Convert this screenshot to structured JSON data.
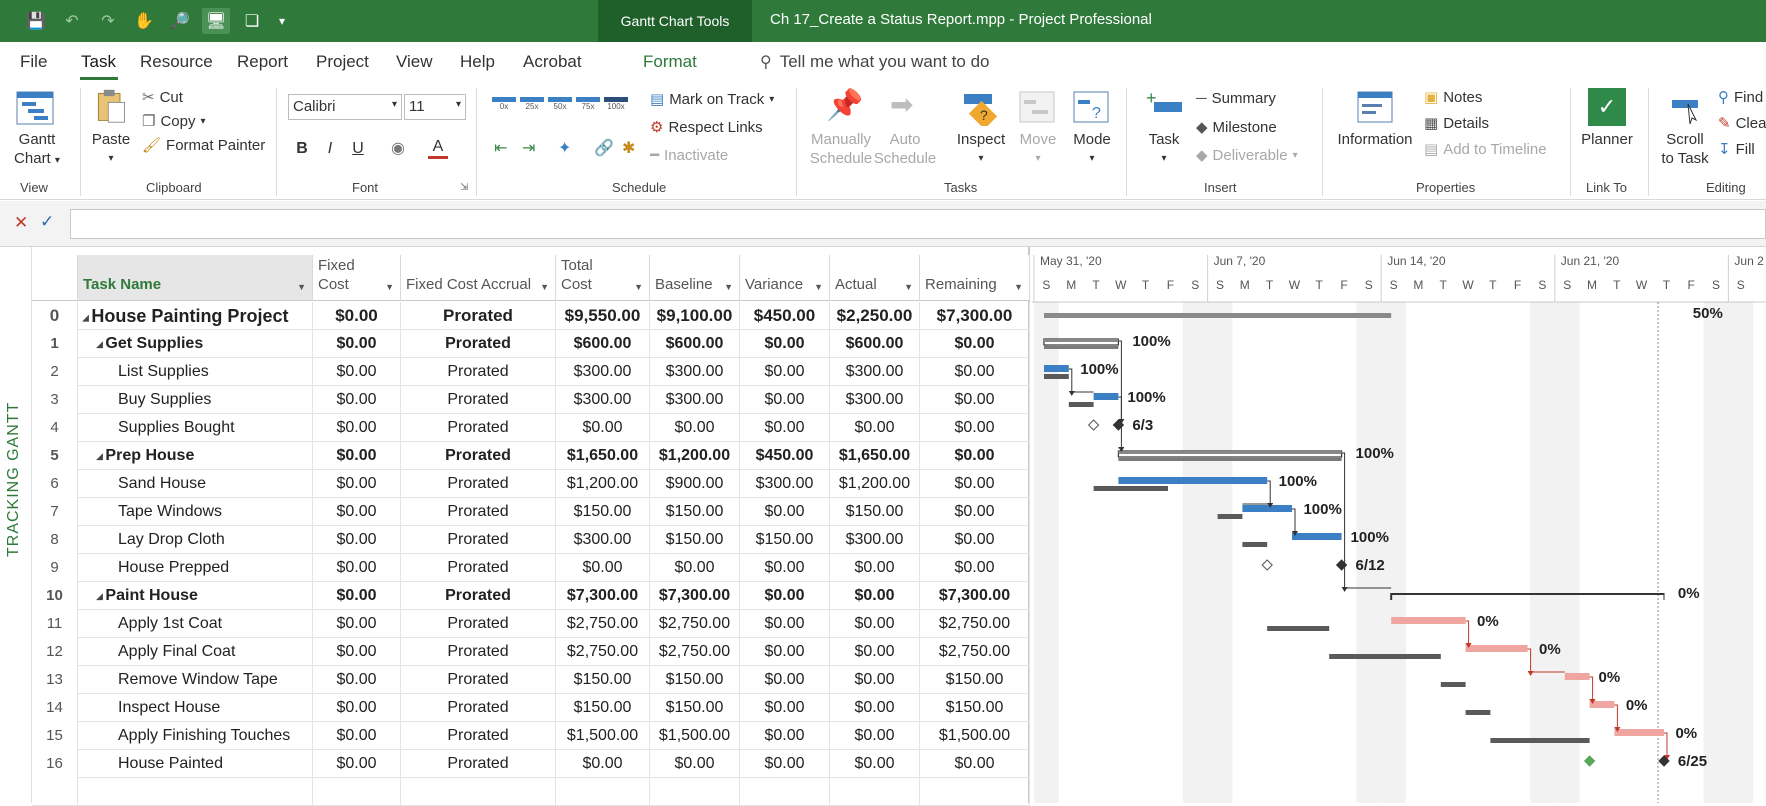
{
  "window": {
    "tools_tab": "Gantt Chart Tools",
    "title": "Ch 17_Create a Status Report.mpp  -  Project Professional"
  },
  "menu": [
    "File",
    "Task",
    "Resource",
    "Report",
    "Project",
    "View",
    "Help",
    "Acrobat",
    "Format"
  ],
  "active_menu": "Task",
  "tellme": "Tell me what you want to do",
  "ribbon": {
    "view": {
      "gantt": "Gantt",
      "chart": "Chart",
      "label": "View"
    },
    "clipboard": {
      "paste": "Paste",
      "cut": "Cut",
      "copy": "Copy",
      "format_painter": "Format Painter",
      "label": "Clipboard"
    },
    "font": {
      "family": "Calibri",
      "size": "11",
      "bold": "B",
      "italic": "I",
      "underline": "U",
      "label": "Font"
    },
    "schedule": {
      "pct": [
        "0x",
        "25x",
        "50x",
        "75x",
        "100x"
      ],
      "mark_on_track": "Mark on Track",
      "respect_links": "Respect Links",
      "inactivate": "Inactivate",
      "label": "Schedule"
    },
    "tasks": {
      "manually1": "Manually",
      "manually2": "Schedule",
      "auto1": "Auto",
      "auto2": "Schedule",
      "inspect": "Inspect",
      "move": "Move",
      "mode": "Mode",
      "label": "Tasks"
    },
    "insert": {
      "task": "Task",
      "summary": "Summary",
      "milestone": "Milestone",
      "deliverable": "Deliverable",
      "label": "Insert"
    },
    "properties": {
      "information": "Information",
      "notes": "Notes",
      "details": "Details",
      "add_to_timeline": "Add to Timeline",
      "label": "Properties"
    },
    "linkto": {
      "planner": "Planner",
      "label": "Link To"
    },
    "editing": {
      "scroll1": "Scroll",
      "scroll2": "to Task",
      "find": "Find",
      "clear": "Clear",
      "fill": "Fill",
      "label": "Editing"
    }
  },
  "sidebar_label": "TRACKING GANTT",
  "columns": [
    {
      "label": "Task Name"
    },
    {
      "label": "Fixed Cost"
    },
    {
      "label": "Fixed Cost Accrual"
    },
    {
      "label": "Total Cost"
    },
    {
      "label": "Baseline"
    },
    {
      "label": "Variance"
    },
    {
      "label": "Actual"
    },
    {
      "label": "Remaining"
    }
  ],
  "rows": [
    {
      "id": "0",
      "name": "House Painting Project",
      "level": 0,
      "summary": true,
      "fixed": "$0.00",
      "accrual": "Prorated",
      "total": "$9,550.00",
      "baseline": "$9,100.00",
      "variance": "$450.00",
      "actual": "$2,250.00",
      "remaining": "$7,300.00"
    },
    {
      "id": "1",
      "name": "Get Supplies",
      "level": 1,
      "summary": true,
      "fixed": "$0.00",
      "accrual": "Prorated",
      "total": "$600.00",
      "baseline": "$600.00",
      "variance": "$0.00",
      "actual": "$600.00",
      "remaining": "$0.00"
    },
    {
      "id": "2",
      "name": "List Supplies",
      "level": 2,
      "summary": false,
      "fixed": "$0.00",
      "accrual": "Prorated",
      "total": "$300.00",
      "baseline": "$300.00",
      "variance": "$0.00",
      "actual": "$300.00",
      "remaining": "$0.00"
    },
    {
      "id": "3",
      "name": "Buy Supplies",
      "level": 2,
      "summary": false,
      "fixed": "$0.00",
      "accrual": "Prorated",
      "total": "$300.00",
      "baseline": "$300.00",
      "variance": "$0.00",
      "actual": "$300.00",
      "remaining": "$0.00"
    },
    {
      "id": "4",
      "name": "Supplies Bought",
      "level": 2,
      "summary": false,
      "fixed": "$0.00",
      "accrual": "Prorated",
      "total": "$0.00",
      "baseline": "$0.00",
      "variance": "$0.00",
      "actual": "$0.00",
      "remaining": "$0.00"
    },
    {
      "id": "5",
      "name": "Prep House",
      "level": 1,
      "summary": true,
      "fixed": "$0.00",
      "accrual": "Prorated",
      "total": "$1,650.00",
      "baseline": "$1,200.00",
      "variance": "$450.00",
      "actual": "$1,650.00",
      "remaining": "$0.00"
    },
    {
      "id": "6",
      "name": "Sand House",
      "level": 2,
      "summary": false,
      "fixed": "$0.00",
      "accrual": "Prorated",
      "total": "$1,200.00",
      "baseline": "$900.00",
      "variance": "$300.00",
      "actual": "$1,200.00",
      "remaining": "$0.00"
    },
    {
      "id": "7",
      "name": "Tape Windows",
      "level": 2,
      "summary": false,
      "fixed": "$0.00",
      "accrual": "Prorated",
      "total": "$150.00",
      "baseline": "$150.00",
      "variance": "$0.00",
      "actual": "$150.00",
      "remaining": "$0.00"
    },
    {
      "id": "8",
      "name": "Lay Drop Cloth",
      "level": 2,
      "summary": false,
      "fixed": "$0.00",
      "accrual": "Prorated",
      "total": "$300.00",
      "baseline": "$150.00",
      "variance": "$150.00",
      "actual": "$300.00",
      "remaining": "$0.00"
    },
    {
      "id": "9",
      "name": "House Prepped",
      "level": 2,
      "summary": false,
      "fixed": "$0.00",
      "accrual": "Prorated",
      "total": "$0.00",
      "baseline": "$0.00",
      "variance": "$0.00",
      "actual": "$0.00",
      "remaining": "$0.00"
    },
    {
      "id": "10",
      "name": "Paint House",
      "level": 1,
      "summary": true,
      "fixed": "$0.00",
      "accrual": "Prorated",
      "total": "$7,300.00",
      "baseline": "$7,300.00",
      "variance": "$0.00",
      "actual": "$0.00",
      "remaining": "$7,300.00"
    },
    {
      "id": "11",
      "name": "Apply 1st Coat",
      "level": 2,
      "summary": false,
      "fixed": "$0.00",
      "accrual": "Prorated",
      "total": "$2,750.00",
      "baseline": "$2,750.00",
      "variance": "$0.00",
      "actual": "$0.00",
      "remaining": "$2,750.00"
    },
    {
      "id": "12",
      "name": "Apply Final Coat",
      "level": 2,
      "summary": false,
      "fixed": "$0.00",
      "accrual": "Prorated",
      "total": "$2,750.00",
      "baseline": "$2,750.00",
      "variance": "$0.00",
      "actual": "$0.00",
      "remaining": "$2,750.00"
    },
    {
      "id": "13",
      "name": "Remove Window Tape",
      "level": 2,
      "summary": false,
      "fixed": "$0.00",
      "accrual": "Prorated",
      "total": "$150.00",
      "baseline": "$150.00",
      "variance": "$0.00",
      "actual": "$0.00",
      "remaining": "$150.00"
    },
    {
      "id": "14",
      "name": "Inspect House",
      "level": 2,
      "summary": false,
      "fixed": "$0.00",
      "accrual": "Prorated",
      "total": "$150.00",
      "baseline": "$150.00",
      "variance": "$0.00",
      "actual": "$0.00",
      "remaining": "$150.00"
    },
    {
      "id": "15",
      "name": "Apply Finishing Touches",
      "level": 2,
      "summary": false,
      "fixed": "$0.00",
      "accrual": "Prorated",
      "total": "$1,500.00",
      "baseline": "$1,500.00",
      "variance": "$0.00",
      "actual": "$0.00",
      "remaining": "$1,500.00"
    },
    {
      "id": "16",
      "name": "House Painted",
      "level": 2,
      "summary": false,
      "fixed": "$0.00",
      "accrual": "Prorated",
      "total": "$0.00",
      "baseline": "$0.00",
      "variance": "$0.00",
      "actual": "$0.00",
      "remaining": "$0.00"
    }
  ],
  "timescale": {
    "weeks": [
      "May 31, '20",
      "Jun 7, '20",
      "Jun 14, '20",
      "Jun 21, '20",
      "Jun 2"
    ],
    "days": [
      "S",
      "M",
      "T",
      "W",
      "T",
      "F",
      "S",
      "S",
      "M",
      "T",
      "W",
      "T",
      "F",
      "S",
      "S",
      "M",
      "T",
      "W",
      "T",
      "F",
      "S",
      "S",
      "M",
      "T",
      "W",
      "T",
      "F",
      "S",
      "S"
    ]
  },
  "gantt_labels": [
    {
      "row": 0,
      "text": "50%"
    },
    {
      "row": 1,
      "text": "100%"
    },
    {
      "row": 2,
      "text": "100%"
    },
    {
      "row": 3,
      "text": "100%"
    },
    {
      "row": 4,
      "text": "6/3"
    },
    {
      "row": 5,
      "text": "100%"
    },
    {
      "row": 6,
      "text": "100%"
    },
    {
      "row": 7,
      "text": "100%"
    },
    {
      "row": 8,
      "text": "100%"
    },
    {
      "row": 9,
      "text": "6/12"
    },
    {
      "row": 10,
      "text": "0%"
    },
    {
      "row": 11,
      "text": "0%"
    },
    {
      "row": 12,
      "text": "0%"
    },
    {
      "row": 13,
      "text": "0%"
    },
    {
      "row": 14,
      "text": "0%"
    },
    {
      "row": 15,
      "text": "0%"
    },
    {
      "row": 16,
      "text": "6/25"
    }
  ],
  "colors": {
    "brand": "#2f7a3a",
    "complete": "#3b7fc4",
    "remaining": "#f0a6a0",
    "baseline": "#5a5a5a",
    "milestone": "#333333"
  }
}
